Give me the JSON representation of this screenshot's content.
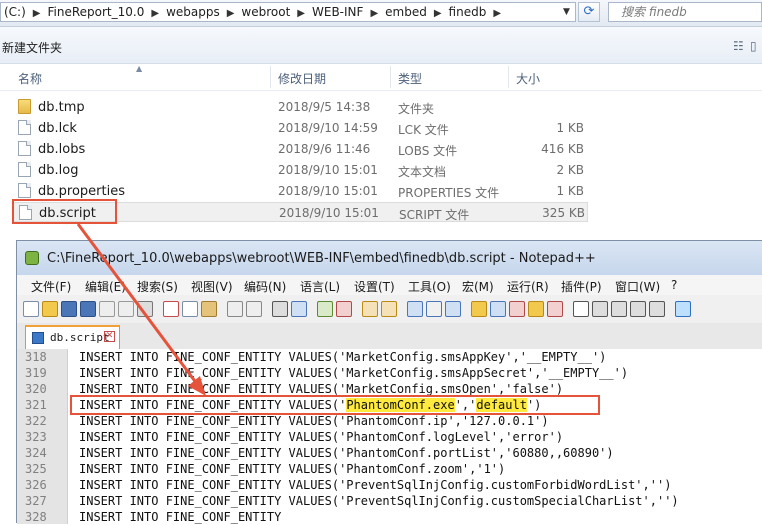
{
  "explorer": {
    "breadcrumbs": [
      "(C:)",
      "FineReport_10.0",
      "webapps",
      "webroot",
      "WEB-INF",
      "embed",
      "finedb"
    ],
    "search_placeholder": "搜索 finedb",
    "new_folder_label": "新建文件夹",
    "columns": {
      "name": "名称",
      "date": "修改日期",
      "type": "类型",
      "size": "大小"
    },
    "files": [
      {
        "name": "db.tmp",
        "date": "2018/9/5 14:38",
        "type": "文件夹",
        "size": "",
        "icon": "folder-icon"
      },
      {
        "name": "db.lck",
        "date": "2018/9/10 14:59",
        "type": "LCK 文件",
        "size": "1 KB",
        "icon": "file-icon"
      },
      {
        "name": "db.lobs",
        "date": "2018/9/6 11:46",
        "type": "LOBS 文件",
        "size": "416 KB",
        "icon": "file-icon"
      },
      {
        "name": "db.log",
        "date": "2018/9/10 15:01",
        "type": "文本文档",
        "size": "2 KB",
        "icon": "file-icon"
      },
      {
        "name": "db.properties",
        "date": "2018/9/10 15:01",
        "type": "PROPERTIES 文件",
        "size": "1 KB",
        "icon": "file-icon"
      },
      {
        "name": "db.script",
        "date": "2018/9/10 15:01",
        "type": "SCRIPT 文件",
        "size": "325 KB",
        "icon": "file-icon"
      }
    ]
  },
  "notepad": {
    "title": "C:\\FineReport_10.0\\webapps\\webroot\\WEB-INF\\embed\\finedb\\db.script - Notepad++",
    "menu": [
      "文件(F)",
      "编辑(E)",
      "搜索(S)",
      "视图(V)",
      "编码(N)",
      "语言(L)",
      "设置(T)",
      "工具(O)",
      "宏(M)",
      "运行(R)",
      "插件(P)",
      "窗口(W)",
      "?"
    ],
    "tab_label": "db.script",
    "lines": [
      {
        "num": "318",
        "code": "INSERT INTO FINE_CONF_ENTITY VALUES('MarketConfig.smsAppKey','__EMPTY__')"
      },
      {
        "num": "319",
        "code": "INSERT INTO FINE_CONF_ENTITY VALUES('MarketConfig.smsAppSecret','__EMPTY__')"
      },
      {
        "num": "320",
        "code": "INSERT INTO FINE_CONF_ENTITY VALUES('MarketConfig.smsOpen','false')"
      },
      {
        "num": "321",
        "code_pre": "INSERT INTO FINE_CONF_ENTITY VALUES('",
        "code_hl1": "PhantomConf.exe",
        "code_mid": "','",
        "code_hl2": "default",
        "code_post": "')"
      },
      {
        "num": "322",
        "code": "INSERT INTO FINE_CONF_ENTITY VALUES('PhantomConf.ip','127.0.0.1')"
      },
      {
        "num": "323",
        "code": "INSERT INTO FINE_CONF_ENTITY VALUES('PhantomConf.logLevel','error')"
      },
      {
        "num": "324",
        "code": "INSERT INTO FINE_CONF_ENTITY VALUES('PhantomConf.portList','60880,,60890')"
      },
      {
        "num": "325",
        "code": "INSERT INTO FINE_CONF_ENTITY VALUES('PhantomConf.zoom','1')"
      },
      {
        "num": "326",
        "code": "INSERT INTO FINE_CONF_ENTITY VALUES('PreventSqlInjConfig.customForbidWordList','')"
      },
      {
        "num": "327",
        "code": "INSERT INTO FINE_CONF_ENTITY VALUES('PreventSqlInjConfig.customSpecialCharList','')"
      },
      {
        "num": "328",
        "code": "INSERT INTO FINE_CONF_ENTITY"
      }
    ]
  },
  "colors": {
    "annotation": "#e5533a",
    "highlight": "#ffea3d"
  }
}
